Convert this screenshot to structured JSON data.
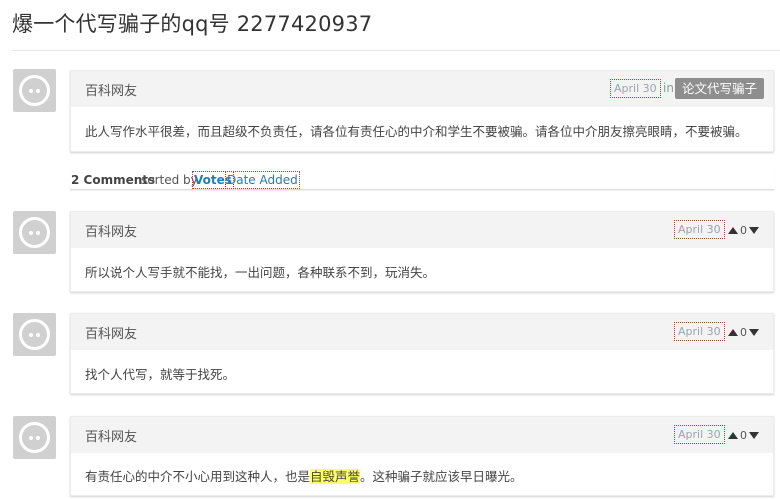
{
  "page": {
    "title": "爆一个代写骗子的qq号 2277420937"
  },
  "question": {
    "author": "百科网友",
    "date": "April 30",
    "in_label": "in",
    "category": "论文代写骗子",
    "body": "此人写作水平很差，而且超级不负责任，请各位有责任心的中介和学生不要被骗。请各位中介朋友擦亮眼睛，不要被骗。"
  },
  "comments_header": {
    "count_label": "2 Comments",
    "sorted_by": "sorted by",
    "options": [
      "Votes",
      "Date Added"
    ],
    "active": "Votes"
  },
  "answers": [
    {
      "author": "百科网友",
      "date": "April 30",
      "votes": "0",
      "body": "所以说个人写手就不能找，一出问题，各种联系不到，玩消失。"
    },
    {
      "author": "百科网友",
      "date": "April 30",
      "votes": "0",
      "body": "找个人代写，就等于找死。"
    },
    {
      "author": "百科网友",
      "date": "April 30",
      "votes": "0",
      "body_before": "有责任心的中介不小心用到这种人，也是",
      "body_highlight": "自毁声誉",
      "body_after": "。这种骗子就应该早日曝光。"
    }
  ],
  "icons": {
    "avatar": "default-avatar-icon",
    "vote_up": "vote-up-arrow-icon",
    "vote_down": "vote-down-arrow-icon"
  },
  "colors": {
    "link": "#2a7ab0",
    "tag_bg": "#8e8e8e",
    "highlight": "#ffff66",
    "card_head": "#f3f3f3"
  }
}
